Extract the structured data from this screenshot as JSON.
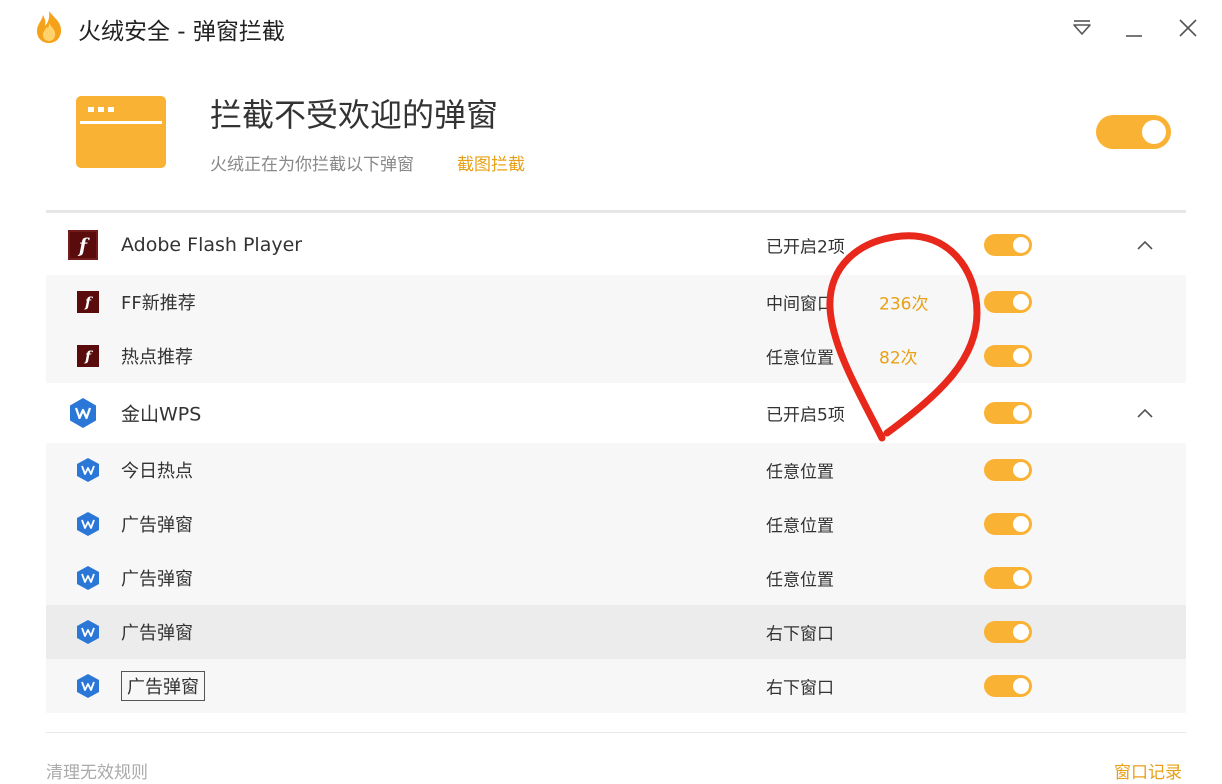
{
  "window": {
    "title": "火绒安全 - 弹窗拦截",
    "icons": {
      "logo": "huorong-flame-icon",
      "menu": "dropdown-menu-icon",
      "minimize": "minimize-icon",
      "close": "close-icon"
    }
  },
  "header": {
    "icon": "popup-window-icon",
    "title": "拦截不受欢迎的弹窗",
    "subtitle": "火绒正在为你拦截以下弹窗",
    "screenshot_link": "截图拦截",
    "toggle_on": true
  },
  "groups": [
    {
      "name": "Adobe Flash Player",
      "icon": "flash-player-icon",
      "status": "已开启2项",
      "enabled": true,
      "expanded": true,
      "items": [
        {
          "name": "FF新推荐",
          "icon": "flash-player-icon",
          "position": "中间窗口",
          "count": "236次",
          "enabled": true
        },
        {
          "name": "热点推荐",
          "icon": "flash-player-icon",
          "position": "任意位置",
          "count": "82次",
          "enabled": true
        }
      ]
    },
    {
      "name": "金山WPS",
      "icon": "wps-icon",
      "status": "已开启5项",
      "enabled": true,
      "expanded": true,
      "items": [
        {
          "name": "今日热点",
          "icon": "wps-icon",
          "position": "任意位置",
          "count": "",
          "enabled": true
        },
        {
          "name": "广告弹窗",
          "icon": "wps-icon",
          "position": "任意位置",
          "count": "",
          "enabled": true
        },
        {
          "name": "广告弹窗",
          "icon": "wps-icon",
          "position": "任意位置",
          "count": "",
          "enabled": true
        },
        {
          "name": "广告弹窗",
          "icon": "wps-icon",
          "position": "右下窗口",
          "count": "",
          "enabled": true
        },
        {
          "name": "广告弹窗",
          "icon": "wps-icon",
          "position": "右下窗口",
          "count": "",
          "enabled": true
        }
      ]
    }
  ],
  "footer": {
    "clear_rules": "清理无效规则",
    "window_log": "窗口记录"
  },
  "colors": {
    "accent": "#f9b233",
    "link": "#e8a016",
    "annotation": "#e8281b",
    "flash_dark": "#5a0c0c",
    "wps_blue": "#2b77d8"
  }
}
